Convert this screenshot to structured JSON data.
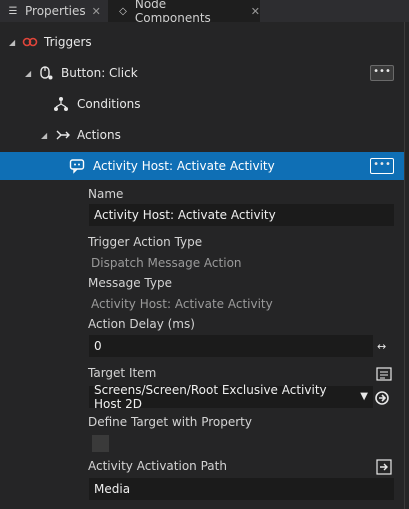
{
  "tabs": [
    {
      "label": "Properties",
      "icon": "list-icon"
    },
    {
      "label": "Node Components",
      "icon": "component-icon"
    }
  ],
  "tree": {
    "triggers": "Triggers",
    "button_click": "Button: Click",
    "conditions": "Conditions",
    "actions": "Actions",
    "activity_host": "Activity Host: Activate Activity",
    "more": "•••"
  },
  "properties": {
    "name_label": "Name",
    "name_value": "Activity Host: Activate Activity",
    "trigger_action_type_label": "Trigger Action Type",
    "trigger_action_type_value": "Dispatch Message Action",
    "message_type_label": "Message Type",
    "message_type_value": "Activity Host: Activate Activity",
    "action_delay_label": "Action Delay (ms)",
    "action_delay_value": "0",
    "target_item_label": "Target Item",
    "target_item_value": "Screens/Screen/Root Exclusive Activity Host 2D",
    "define_target_label": "Define Target with Property",
    "activation_path_label": "Activity Activation Path",
    "activation_path_value": "Media"
  },
  "colors": {
    "selection": "#0f6fb5",
    "trigger_icon": "#e0453a"
  }
}
